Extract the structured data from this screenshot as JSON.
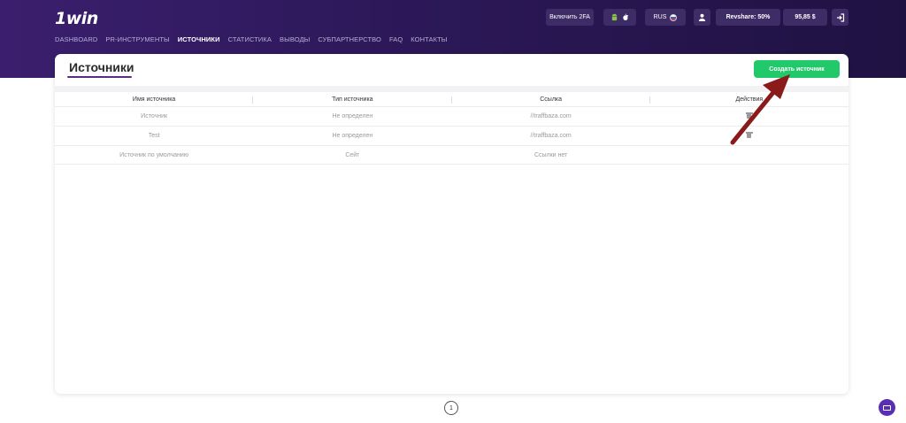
{
  "header": {
    "logo_text": "1win",
    "nav": [
      {
        "label": "DASHBOARD",
        "active": false
      },
      {
        "label": "PR-ИНСТРУМЕНТЫ",
        "active": false
      },
      {
        "label": "ИСТОЧНИКИ",
        "active": true
      },
      {
        "label": "СТАТИСТИКА",
        "active": false
      },
      {
        "label": "ВЫВОДЫ",
        "active": false
      },
      {
        "label": "СУБПАРТНЕРСТВО",
        "active": false
      },
      {
        "label": "FAQ",
        "active": false
      },
      {
        "label": "КОНТАКТЫ",
        "active": false
      }
    ],
    "enable_2fa": "Включить 2FA",
    "language": "RUS",
    "revshare": "Revshare: 50%",
    "balance": "95,85 $"
  },
  "page": {
    "title": "Источники",
    "create_button": "Создать источник"
  },
  "table": {
    "columns": [
      "Имя источника",
      "Тип источника",
      "Ссылка",
      "Действия"
    ],
    "rows": [
      {
        "name": "Источник",
        "type": "Не определен",
        "link": "//traffbaza.com",
        "deletable": true
      },
      {
        "name": "Test",
        "type": "Не определен",
        "link": "//traffbaza.com",
        "deletable": true
      },
      {
        "name": "Источник по умолчанию",
        "type": "Сейт",
        "link": "Ссылки нет",
        "deletable": false
      }
    ]
  },
  "pagination": {
    "current": "1"
  },
  "colors": {
    "accent_green": "#21c96b",
    "header_purple": "#2c1858",
    "annotation_arrow": "#8b1a1a"
  }
}
